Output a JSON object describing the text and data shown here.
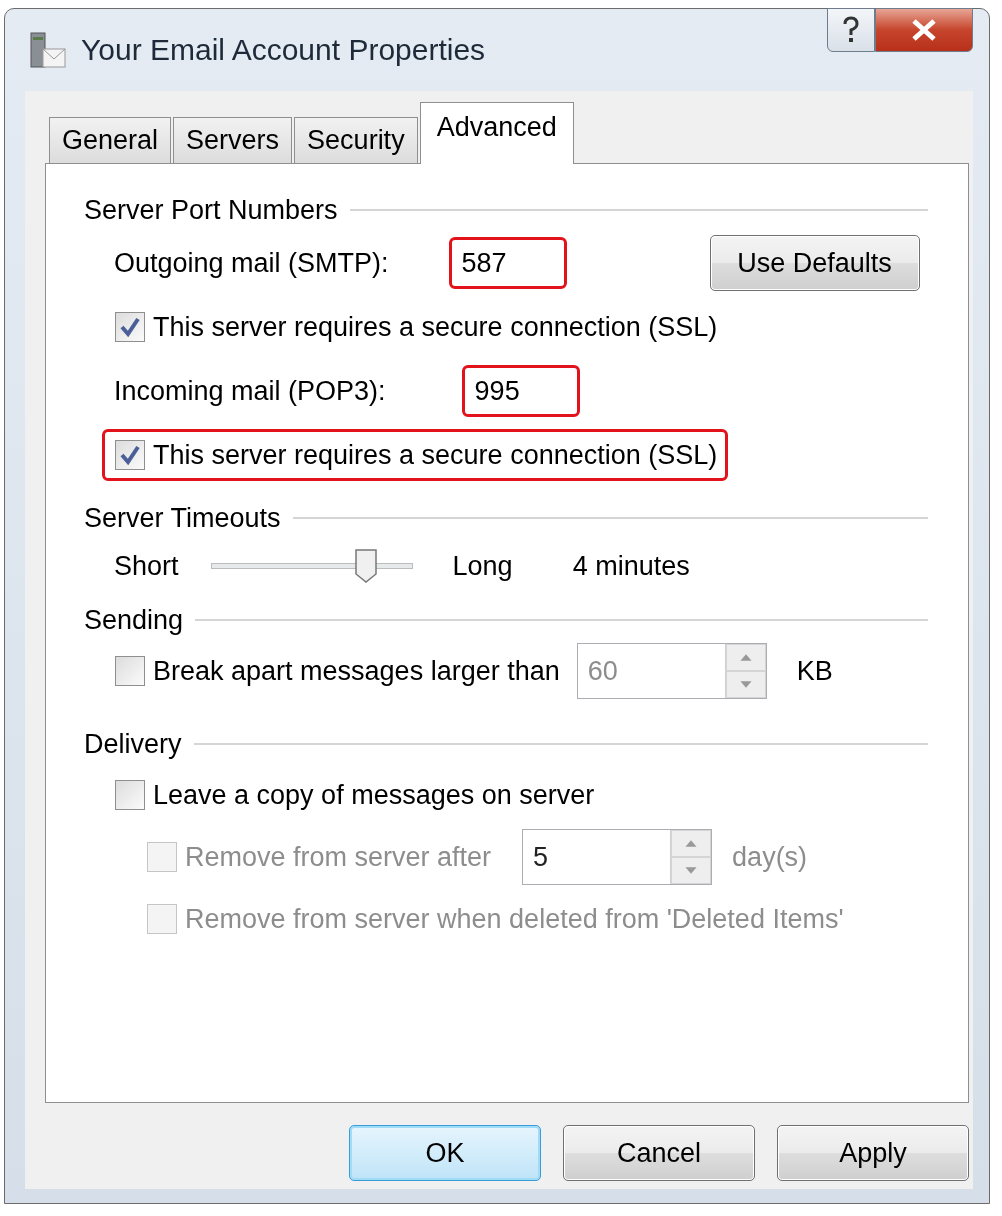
{
  "window": {
    "title": "Your Email Account Properties"
  },
  "tabs": [
    {
      "label": "General",
      "selected": false
    },
    {
      "label": "Servers",
      "selected": false
    },
    {
      "label": "Security",
      "selected": false
    },
    {
      "label": "Advanced",
      "selected": true
    }
  ],
  "sections": [
    {
      "title": "Server Port Numbers",
      "rows": [
        {
          "kind": "port",
          "label": "Outgoing mail (SMTP):",
          "value": "587",
          "highlighted": true,
          "button": "Use Defaults"
        },
        {
          "kind": "checkbox",
          "label": "This server requires a secure connection (SSL)",
          "checked": true,
          "disabled": false,
          "highlighted": false
        },
        {
          "kind": "port",
          "label": "Incoming mail (POP3):",
          "value": "995",
          "highlighted": true
        },
        {
          "kind": "checkbox",
          "label": "This server requires a secure connection (SSL)",
          "checked": true,
          "disabled": false,
          "highlighted": true
        }
      ]
    },
    {
      "title": "Server Timeouts",
      "rows": [
        {
          "kind": "slider",
          "min_label": "Short",
          "max_label": "Long",
          "level": 0.77,
          "reading": "4 minutes"
        }
      ]
    },
    {
      "title": "Sending",
      "rows": [
        {
          "kind": "checkbox",
          "label": "Break apart messages larger than",
          "checked": false,
          "disabled": false,
          "highlighted": false,
          "spinner": {
            "value": "60",
            "disabled": true
          },
          "unit": "KB"
        }
      ]
    },
    {
      "title": "Delivery",
      "rows": [
        {
          "kind": "checkbox",
          "label": "Leave a copy of messages on server",
          "checked": false,
          "disabled": false,
          "highlighted": false,
          "children": [
            {
              "kind": "checkbox",
              "label": "Remove from server after",
              "checked": false,
              "disabled": true,
              "highlighted": false,
              "spinner": {
                "value": "5",
                "disabled": false
              },
              "unit": "day(s)"
            },
            {
              "kind": "checkbox",
              "label": "Remove from server when deleted from 'Deleted Items'",
              "checked": false,
              "disabled": true,
              "highlighted": false
            }
          ]
        }
      ]
    }
  ],
  "buttons": [
    {
      "label": "OK",
      "default": true
    },
    {
      "label": "Cancel",
      "default": false
    },
    {
      "label": "Apply",
      "default": false
    }
  ]
}
